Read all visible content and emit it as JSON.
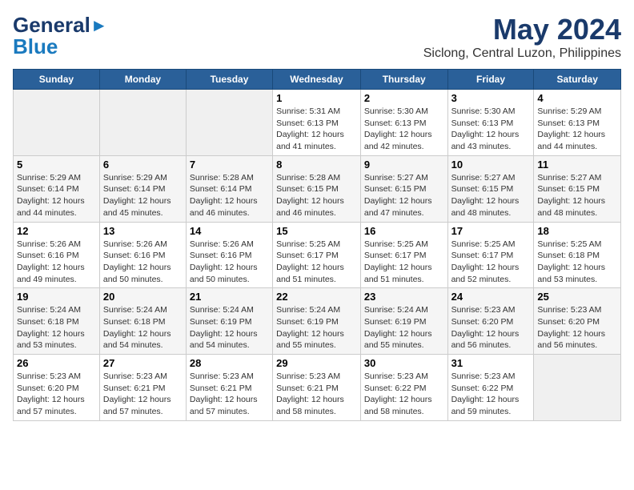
{
  "header": {
    "logo_line1": "General",
    "logo_line2": "Blue",
    "title": "May 2024",
    "subtitle": "Siclong, Central Luzon, Philippines"
  },
  "days_of_week": [
    "Sunday",
    "Monday",
    "Tuesday",
    "Wednesday",
    "Thursday",
    "Friday",
    "Saturday"
  ],
  "weeks": [
    [
      {
        "day": "",
        "detail": ""
      },
      {
        "day": "",
        "detail": ""
      },
      {
        "day": "",
        "detail": ""
      },
      {
        "day": "1",
        "detail": "Sunrise: 5:31 AM\nSunset: 6:13 PM\nDaylight: 12 hours\nand 41 minutes."
      },
      {
        "day": "2",
        "detail": "Sunrise: 5:30 AM\nSunset: 6:13 PM\nDaylight: 12 hours\nand 42 minutes."
      },
      {
        "day": "3",
        "detail": "Sunrise: 5:30 AM\nSunset: 6:13 PM\nDaylight: 12 hours\nand 43 minutes."
      },
      {
        "day": "4",
        "detail": "Sunrise: 5:29 AM\nSunset: 6:13 PM\nDaylight: 12 hours\nand 44 minutes."
      }
    ],
    [
      {
        "day": "5",
        "detail": "Sunrise: 5:29 AM\nSunset: 6:14 PM\nDaylight: 12 hours\nand 44 minutes."
      },
      {
        "day": "6",
        "detail": "Sunrise: 5:29 AM\nSunset: 6:14 PM\nDaylight: 12 hours\nand 45 minutes."
      },
      {
        "day": "7",
        "detail": "Sunrise: 5:28 AM\nSunset: 6:14 PM\nDaylight: 12 hours\nand 46 minutes."
      },
      {
        "day": "8",
        "detail": "Sunrise: 5:28 AM\nSunset: 6:15 PM\nDaylight: 12 hours\nand 46 minutes."
      },
      {
        "day": "9",
        "detail": "Sunrise: 5:27 AM\nSunset: 6:15 PM\nDaylight: 12 hours\nand 47 minutes."
      },
      {
        "day": "10",
        "detail": "Sunrise: 5:27 AM\nSunset: 6:15 PM\nDaylight: 12 hours\nand 48 minutes."
      },
      {
        "day": "11",
        "detail": "Sunrise: 5:27 AM\nSunset: 6:15 PM\nDaylight: 12 hours\nand 48 minutes."
      }
    ],
    [
      {
        "day": "12",
        "detail": "Sunrise: 5:26 AM\nSunset: 6:16 PM\nDaylight: 12 hours\nand 49 minutes."
      },
      {
        "day": "13",
        "detail": "Sunrise: 5:26 AM\nSunset: 6:16 PM\nDaylight: 12 hours\nand 50 minutes."
      },
      {
        "day": "14",
        "detail": "Sunrise: 5:26 AM\nSunset: 6:16 PM\nDaylight: 12 hours\nand 50 minutes."
      },
      {
        "day": "15",
        "detail": "Sunrise: 5:25 AM\nSunset: 6:17 PM\nDaylight: 12 hours\nand 51 minutes."
      },
      {
        "day": "16",
        "detail": "Sunrise: 5:25 AM\nSunset: 6:17 PM\nDaylight: 12 hours\nand 51 minutes."
      },
      {
        "day": "17",
        "detail": "Sunrise: 5:25 AM\nSunset: 6:17 PM\nDaylight: 12 hours\nand 52 minutes."
      },
      {
        "day": "18",
        "detail": "Sunrise: 5:25 AM\nSunset: 6:18 PM\nDaylight: 12 hours\nand 53 minutes."
      }
    ],
    [
      {
        "day": "19",
        "detail": "Sunrise: 5:24 AM\nSunset: 6:18 PM\nDaylight: 12 hours\nand 53 minutes."
      },
      {
        "day": "20",
        "detail": "Sunrise: 5:24 AM\nSunset: 6:18 PM\nDaylight: 12 hours\nand 54 minutes."
      },
      {
        "day": "21",
        "detail": "Sunrise: 5:24 AM\nSunset: 6:19 PM\nDaylight: 12 hours\nand 54 minutes."
      },
      {
        "day": "22",
        "detail": "Sunrise: 5:24 AM\nSunset: 6:19 PM\nDaylight: 12 hours\nand 55 minutes."
      },
      {
        "day": "23",
        "detail": "Sunrise: 5:24 AM\nSunset: 6:19 PM\nDaylight: 12 hours\nand 55 minutes."
      },
      {
        "day": "24",
        "detail": "Sunrise: 5:23 AM\nSunset: 6:20 PM\nDaylight: 12 hours\nand 56 minutes."
      },
      {
        "day": "25",
        "detail": "Sunrise: 5:23 AM\nSunset: 6:20 PM\nDaylight: 12 hours\nand 56 minutes."
      }
    ],
    [
      {
        "day": "26",
        "detail": "Sunrise: 5:23 AM\nSunset: 6:20 PM\nDaylight: 12 hours\nand 57 minutes."
      },
      {
        "day": "27",
        "detail": "Sunrise: 5:23 AM\nSunset: 6:21 PM\nDaylight: 12 hours\nand 57 minutes."
      },
      {
        "day": "28",
        "detail": "Sunrise: 5:23 AM\nSunset: 6:21 PM\nDaylight: 12 hours\nand 57 minutes."
      },
      {
        "day": "29",
        "detail": "Sunrise: 5:23 AM\nSunset: 6:21 PM\nDaylight: 12 hours\nand 58 minutes."
      },
      {
        "day": "30",
        "detail": "Sunrise: 5:23 AM\nSunset: 6:22 PM\nDaylight: 12 hours\nand 58 minutes."
      },
      {
        "day": "31",
        "detail": "Sunrise: 5:23 AM\nSunset: 6:22 PM\nDaylight: 12 hours\nand 59 minutes."
      },
      {
        "day": "",
        "detail": ""
      }
    ]
  ]
}
